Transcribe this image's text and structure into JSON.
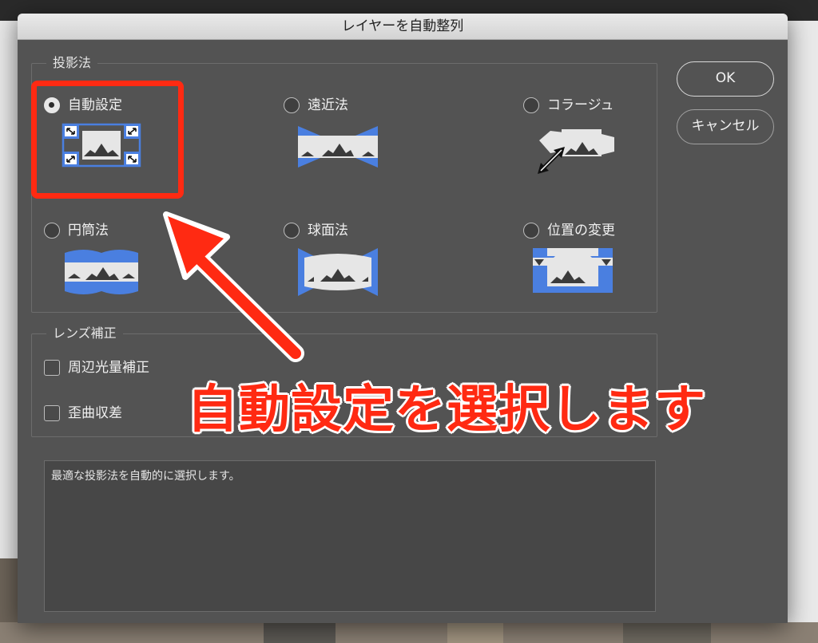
{
  "dialog": {
    "title": "レイヤーを自動整列",
    "ok_label": "OK",
    "cancel_label": "キャンセル"
  },
  "projection": {
    "title": "投影法",
    "options": [
      {
        "label": "自動設定",
        "selected": true,
        "icon": "auto-icon"
      },
      {
        "label": "遠近法",
        "selected": false,
        "icon": "perspective-icon"
      },
      {
        "label": "コラージュ",
        "selected": false,
        "icon": "collage-icon"
      },
      {
        "label": "円筒法",
        "selected": false,
        "icon": "cylindrical-icon"
      },
      {
        "label": "球面法",
        "selected": false,
        "icon": "spherical-icon"
      },
      {
        "label": "位置の変更",
        "selected": false,
        "icon": "reposition-icon"
      }
    ]
  },
  "lens": {
    "title": "レンズ補正",
    "vignette_label": "周辺光量補正",
    "vignette_checked": false,
    "distortion_label": "歪曲収差",
    "distortion_checked": false
  },
  "description": "最適な投影法を自動的に選択します。",
  "annotation": {
    "text": "自動設定を選択します",
    "color": "#ff2a12"
  },
  "colors": {
    "dialog_bg": "#535353",
    "accent_blue": "#4a7fe0",
    "icon_light": "#e6e6e6"
  }
}
